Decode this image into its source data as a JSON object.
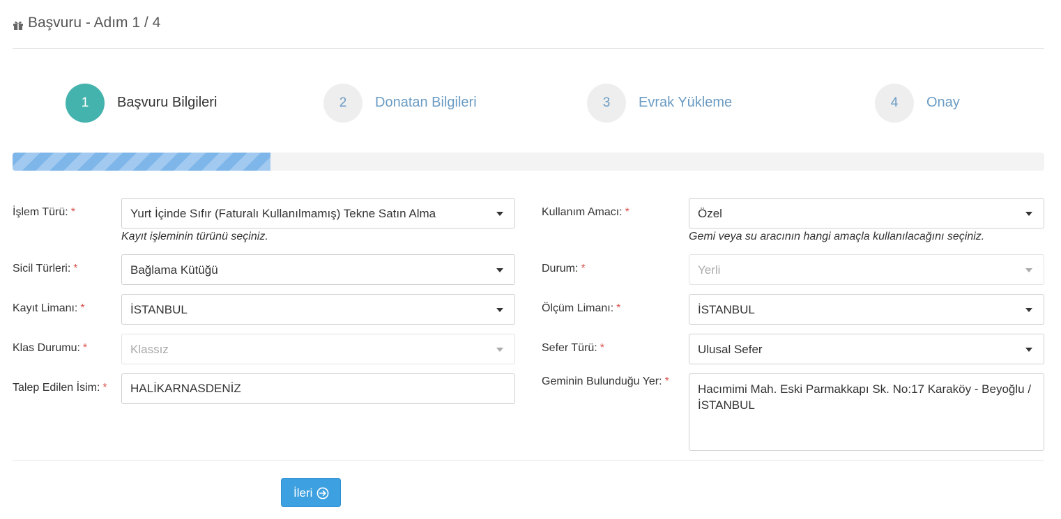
{
  "header": {
    "title": "Başvuru - Adım 1 / 4",
    "icon": "gift-icon"
  },
  "steps": [
    {
      "number": "1",
      "label": "Başvuru Bilgileri"
    },
    {
      "number": "2",
      "label": "Donatan Bilgileri"
    },
    {
      "number": "3",
      "label": "Evrak Yükleme"
    },
    {
      "number": "4",
      "label": "Onay"
    }
  ],
  "progress": {
    "percent": 25,
    "color": "#7eb6ea"
  },
  "form": {
    "islem_turu": {
      "label": "İşlem Türü:",
      "value": "Yurt İçinde Sıfır (Faturalı Kullanılmamış) Tekne Satın Alma",
      "help": "Kayıt işleminin türünü seçiniz."
    },
    "kullanim_amaci": {
      "label": "Kullanım Amacı:",
      "value": "Özel",
      "help": "Gemi veya su aracının hangi amaçla kullanılacağını seçiniz."
    },
    "sicil_turleri": {
      "label": "Sicil Türleri:",
      "value": "Bağlama Kütüğü"
    },
    "durum": {
      "label": "Durum:",
      "value": "Yerli"
    },
    "kayit_limani": {
      "label": "Kayıt Limanı:",
      "value": "İSTANBUL"
    },
    "olcum_limani": {
      "label": "Ölçüm Limanı:",
      "value": "İSTANBUL"
    },
    "klas_durumu": {
      "label": "Klas Durumu:",
      "value": "Klassız"
    },
    "sefer_turu": {
      "label": "Sefer Türü:",
      "value": "Ulusal Sefer"
    },
    "talep_edilen_isim": {
      "label": "Talep Edilen İsim:",
      "value": "HALİKARNASDENİZ"
    },
    "bulundugu_yer": {
      "label": "Geminin Bulunduğu Yer:",
      "value": "Hacımimi Mah. Eski Parmakkapı Sk. No:17 Karaköy - Beyoğlu / İSTANBUL"
    },
    "required_mark": "*"
  },
  "buttons": {
    "next_label": "İleri"
  },
  "colors": {
    "accent": "#45b3ad",
    "primary_button": "#3da0e0",
    "required": "#d9534f",
    "step_inactive_text": "#6a9bc3"
  }
}
